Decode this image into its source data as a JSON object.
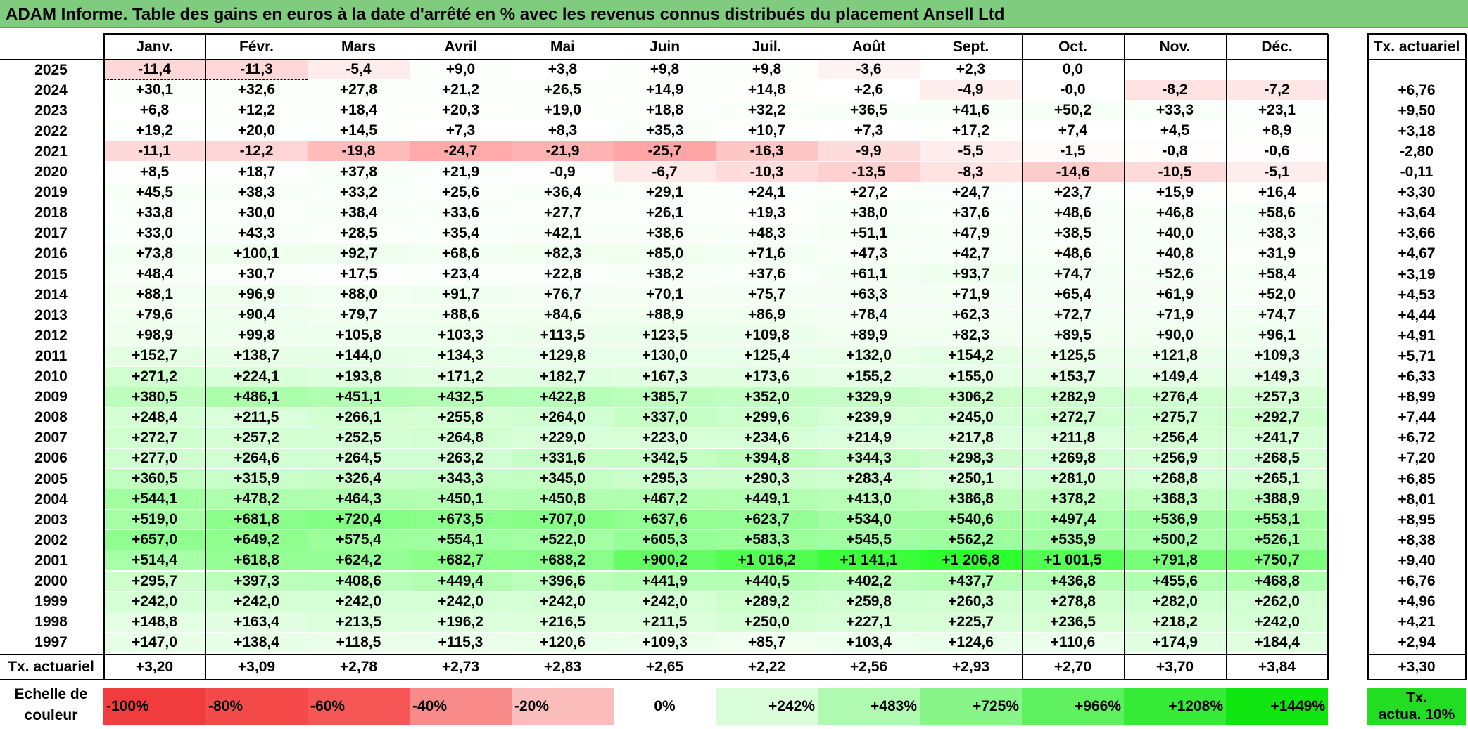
{
  "title": "ADAM Informe. Table des gains en euros à la date d'arrêté en % avec les revenus connus distribués du placement Ansell Ltd",
  "months": [
    "Janv.",
    "Févr.",
    "Mars",
    "Avril",
    "Mai",
    "Juin",
    "Juil.",
    "Août",
    "Sept.",
    "Oct.",
    "Nov.",
    "Déc."
  ],
  "rate_header": "Tx. actuariel",
  "rows": [
    {
      "year": "2025",
      "values": [
        "-11,4",
        "-11,3",
        "-5,4",
        "+9,0",
        "+3,8",
        "+9,8",
        "+9,8",
        "-3,6",
        "+2,3",
        "0,0",
        "",
        ""
      ],
      "rate": ""
    },
    {
      "year": "2024",
      "values": [
        "+30,1",
        "+32,6",
        "+27,8",
        "+21,2",
        "+26,5",
        "+14,9",
        "+14,8",
        "+2,6",
        "-4,9",
        "-0,0",
        "-8,2",
        "-7,2"
      ],
      "rate": "+6,76"
    },
    {
      "year": "2023",
      "values": [
        "+6,8",
        "+12,2",
        "+18,4",
        "+20,3",
        "+19,0",
        "+18,8",
        "+32,2",
        "+36,5",
        "+41,6",
        "+50,2",
        "+33,3",
        "+23,1"
      ],
      "rate": "+9,50"
    },
    {
      "year": "2022",
      "values": [
        "+19,2",
        "+20,0",
        "+14,5",
        "+7,3",
        "+8,3",
        "+35,3",
        "+10,7",
        "+7,3",
        "+17,2",
        "+7,4",
        "+4,5",
        "+8,9"
      ],
      "rate": "+3,18"
    },
    {
      "year": "2021",
      "values": [
        "-11,1",
        "-12,2",
        "-19,8",
        "-24,7",
        "-21,9",
        "-25,7",
        "-16,3",
        "-9,9",
        "-5,5",
        "-1,5",
        "-0,8",
        "-0,6"
      ],
      "rate": "-2,80"
    },
    {
      "year": "2020",
      "values": [
        "+8,5",
        "+18,7",
        "+37,8",
        "+21,9",
        "-0,9",
        "-6,7",
        "-10,3",
        "-13,5",
        "-8,3",
        "-14,6",
        "-10,5",
        "-5,1"
      ],
      "rate": "-0,11"
    },
    {
      "year": "2019",
      "values": [
        "+45,5",
        "+38,3",
        "+33,2",
        "+25,6",
        "+36,4",
        "+29,1",
        "+24,1",
        "+27,2",
        "+24,7",
        "+23,7",
        "+15,9",
        "+16,4"
      ],
      "rate": "+3,30"
    },
    {
      "year": "2018",
      "values": [
        "+33,8",
        "+30,0",
        "+38,4",
        "+33,6",
        "+27,7",
        "+26,1",
        "+19,3",
        "+38,0",
        "+37,6",
        "+48,6",
        "+46,8",
        "+58,6"
      ],
      "rate": "+3,64"
    },
    {
      "year": "2017",
      "values": [
        "+33,0",
        "+43,3",
        "+28,5",
        "+35,4",
        "+42,1",
        "+38,6",
        "+48,3",
        "+51,1",
        "+47,9",
        "+38,5",
        "+40,0",
        "+38,3"
      ],
      "rate": "+3,66"
    },
    {
      "year": "2016",
      "values": [
        "+73,8",
        "+100,1",
        "+92,7",
        "+68,6",
        "+82,3",
        "+85,0",
        "+71,6",
        "+47,3",
        "+42,7",
        "+48,6",
        "+40,8",
        "+31,9"
      ],
      "rate": "+4,67"
    },
    {
      "year": "2015",
      "values": [
        "+48,4",
        "+30,7",
        "+17,5",
        "+23,4",
        "+22,8",
        "+38,2",
        "+37,6",
        "+61,1",
        "+93,7",
        "+74,7",
        "+52,6",
        "+58,4"
      ],
      "rate": "+3,19"
    },
    {
      "year": "2014",
      "values": [
        "+88,1",
        "+96,9",
        "+88,0",
        "+91,7",
        "+76,7",
        "+70,1",
        "+75,7",
        "+63,3",
        "+71,9",
        "+65,4",
        "+61,9",
        "+52,0"
      ],
      "rate": "+4,53"
    },
    {
      "year": "2013",
      "values": [
        "+79,6",
        "+90,4",
        "+79,7",
        "+88,6",
        "+84,6",
        "+88,9",
        "+86,9",
        "+78,4",
        "+62,3",
        "+72,7",
        "+71,9",
        "+74,7"
      ],
      "rate": "+4,44"
    },
    {
      "year": "2012",
      "values": [
        "+98,9",
        "+99,8",
        "+105,8",
        "+103,3",
        "+113,5",
        "+123,5",
        "+109,8",
        "+89,9",
        "+82,3",
        "+89,5",
        "+90,0",
        "+96,1"
      ],
      "rate": "+4,91"
    },
    {
      "year": "2011",
      "values": [
        "+152,7",
        "+138,7",
        "+144,0",
        "+134,3",
        "+129,8",
        "+130,0",
        "+125,4",
        "+132,0",
        "+154,2",
        "+125,5",
        "+121,8",
        "+109,3"
      ],
      "rate": "+5,71"
    },
    {
      "year": "2010",
      "values": [
        "+271,2",
        "+224,1",
        "+193,8",
        "+171,2",
        "+182,7",
        "+167,3",
        "+173,6",
        "+155,2",
        "+155,0",
        "+153,7",
        "+149,4",
        "+149,3"
      ],
      "rate": "+6,33"
    },
    {
      "year": "2009",
      "values": [
        "+380,5",
        "+486,1",
        "+451,1",
        "+432,5",
        "+422,8",
        "+385,7",
        "+352,0",
        "+329,9",
        "+306,2",
        "+282,9",
        "+276,4",
        "+257,3"
      ],
      "rate": "+8,99"
    },
    {
      "year": "2008",
      "values": [
        "+248,4",
        "+211,5",
        "+266,1",
        "+255,8",
        "+264,0",
        "+337,0",
        "+299,6",
        "+239,9",
        "+245,0",
        "+272,7",
        "+275,7",
        "+292,7"
      ],
      "rate": "+7,44"
    },
    {
      "year": "2007",
      "values": [
        "+272,7",
        "+257,2",
        "+252,5",
        "+264,8",
        "+229,0",
        "+223,0",
        "+234,6",
        "+214,9",
        "+217,8",
        "+211,8",
        "+256,4",
        "+241,7"
      ],
      "rate": "+6,72"
    },
    {
      "year": "2006",
      "values": [
        "+277,0",
        "+264,6",
        "+264,5",
        "+263,2",
        "+331,6",
        "+342,5",
        "+394,8",
        "+344,3",
        "+298,3",
        "+269,8",
        "+256,9",
        "+268,5"
      ],
      "rate": "+7,20"
    },
    {
      "year": "2005",
      "values": [
        "+360,5",
        "+315,9",
        "+326,4",
        "+343,3",
        "+345,0",
        "+295,3",
        "+290,3",
        "+283,4",
        "+250,1",
        "+281,0",
        "+268,8",
        "+265,1"
      ],
      "rate": "+6,85"
    },
    {
      "year": "2004",
      "values": [
        "+544,1",
        "+478,2",
        "+464,3",
        "+450,1",
        "+450,8",
        "+467,2",
        "+449,1",
        "+413,0",
        "+386,8",
        "+378,2",
        "+368,3",
        "+388,9"
      ],
      "rate": "+8,01"
    },
    {
      "year": "2003",
      "values": [
        "+519,0",
        "+681,8",
        "+720,4",
        "+673,5",
        "+707,0",
        "+637,6",
        "+623,7",
        "+534,0",
        "+540,6",
        "+497,4",
        "+536,9",
        "+553,1"
      ],
      "rate": "+8,95"
    },
    {
      "year": "2002",
      "values": [
        "+657,0",
        "+649,2",
        "+575,4",
        "+554,1",
        "+522,0",
        "+605,3",
        "+583,3",
        "+545,5",
        "+562,2",
        "+535,9",
        "+500,2",
        "+526,1"
      ],
      "rate": "+8,38"
    },
    {
      "year": "2001",
      "values": [
        "+514,4",
        "+618,8",
        "+624,2",
        "+682,7",
        "+688,2",
        "+900,2",
        "+1 016,2",
        "+1 141,1",
        "+1 206,8",
        "+1 001,5",
        "+791,8",
        "+750,7"
      ],
      "rate": "+9,40"
    },
    {
      "year": "2000",
      "values": [
        "+295,7",
        "+397,3",
        "+408,6",
        "+449,4",
        "+396,6",
        "+441,9",
        "+440,5",
        "+402,2",
        "+437,7",
        "+436,8",
        "+455,6",
        "+468,8"
      ],
      "rate": "+6,76"
    },
    {
      "year": "1999",
      "values": [
        "+242,0",
        "+242,0",
        "+242,0",
        "+242,0",
        "+242,0",
        "+242,0",
        "+289,2",
        "+259,8",
        "+260,3",
        "+278,8",
        "+282,0",
        "+262,0"
      ],
      "rate": "+4,96"
    },
    {
      "year": "1998",
      "values": [
        "+148,8",
        "+163,4",
        "+213,5",
        "+196,2",
        "+216,5",
        "+211,5",
        "+250,0",
        "+227,1",
        "+225,7",
        "+236,5",
        "+218,2",
        "+242,0"
      ],
      "rate": "+4,21"
    },
    {
      "year": "1997",
      "values": [
        "+147,0",
        "+138,4",
        "+118,5",
        "+115,3",
        "+120,6",
        "+109,3",
        "+85,7",
        "+103,4",
        "+124,6",
        "+110,6",
        "+174,9",
        "+184,4"
      ],
      "rate": "+2,94"
    }
  ],
  "footer": {
    "label": "Tx. actuariel",
    "values": [
      "+3,20",
      "+3,09",
      "+2,78",
      "+2,73",
      "+2,83",
      "+2,65",
      "+2,22",
      "+2,56",
      "+2,93",
      "+2,70",
      "+3,70",
      "+3,84"
    ],
    "rate": "+3,30"
  },
  "scale": {
    "label_line1": "Echelle de",
    "label_line2": "couleur",
    "steps": [
      {
        "text": "-100%",
        "color": "#f03c3c",
        "align": "left"
      },
      {
        "text": "-80%",
        "color": "#f44a4a",
        "align": "left"
      },
      {
        "text": "-60%",
        "color": "#f65656",
        "align": "left"
      },
      {
        "text": "-40%",
        "color": "#f88a8a",
        "align": "left"
      },
      {
        "text": "-20%",
        "color": "#fbbcbc",
        "align": "left"
      },
      {
        "text": "0%",
        "color": "#ffffff",
        "align": "center"
      },
      {
        "text": "+242%",
        "color": "#d9fdd9",
        "align": "right"
      },
      {
        "text": "+483%",
        "color": "#b0f9b0",
        "align": "right"
      },
      {
        "text": "+725%",
        "color": "#88f588",
        "align": "right"
      },
      {
        "text": "+966%",
        "color": "#5ff05f",
        "align": "right"
      },
      {
        "text": "+1208%",
        "color": "#36eb36",
        "align": "right"
      },
      {
        "text": "+1449%",
        "color": "#10e610",
        "align": "right"
      }
    ],
    "legend_line1": "Tx.",
    "legend_line2": "actua. 10%",
    "legend_color": "#22dd22"
  },
  "colors": {
    "title_bg": "#7fcc7f",
    "neg_max": "#f03c3c",
    "pos_max": "#10e610"
  }
}
